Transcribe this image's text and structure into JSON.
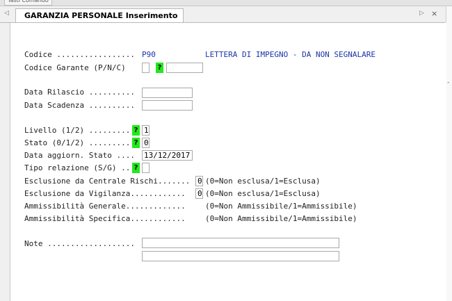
{
  "toolbar": {
    "cut_label": "Tasti Comando"
  },
  "tab": {
    "title": "GARANZIA PERSONALE",
    "mode": "Inserimento"
  },
  "icons": {
    "prev": "◁",
    "next": "▷",
    "close": "×",
    "lookup": "?"
  },
  "form": {
    "codice": {
      "label": "Codice .................",
      "value": "P90",
      "description": "LETTERA DI IMPEGNO - DA NON SEGNALARE"
    },
    "codice_garante": {
      "label": "Codice Garante (P/N/C)",
      "value1": "",
      "value2": ""
    },
    "data_rilascio": {
      "label": "Data Rilascio ..........",
      "value": ""
    },
    "data_scadenza": {
      "label": "Data Scadenza ..........",
      "value": ""
    },
    "livello": {
      "label": "Livello (1/2) .........",
      "value": "1"
    },
    "stato": {
      "label": "Stato (0/1/2) .........",
      "value": "0"
    },
    "data_aggiorn_stato": {
      "label": "Data aggiorn. Stato ....",
      "value": "13/12/2017"
    },
    "tipo_relazione": {
      "label": "Tipo relazione (S/G) ..",
      "value": ""
    },
    "esclusione_cr": {
      "label": "Esclusione da Centrale Rischi.......",
      "value": "0",
      "hint": "(0=Non esclusa/1=Esclusa)"
    },
    "esclusione_vig": {
      "label": "Esclusione da Vigilanza............",
      "value": "0",
      "hint": "(0=Non esclusa/1=Esclusa)"
    },
    "ammissibilita_generale": {
      "label": "Ammissibilità Generale.............",
      "hint": "(0=Non Ammissibile/1=Ammissibile)"
    },
    "ammissibilita_specifica": {
      "label": "Ammissibilità Specifica............",
      "hint": "(0=Non Ammissibile/1=Ammissibile)"
    },
    "note": {
      "label": "Note ...................",
      "line1": "",
      "line2": ""
    }
  },
  "colors": {
    "lookup_bg": "#22e81b",
    "value_text": "#1b35a8"
  }
}
